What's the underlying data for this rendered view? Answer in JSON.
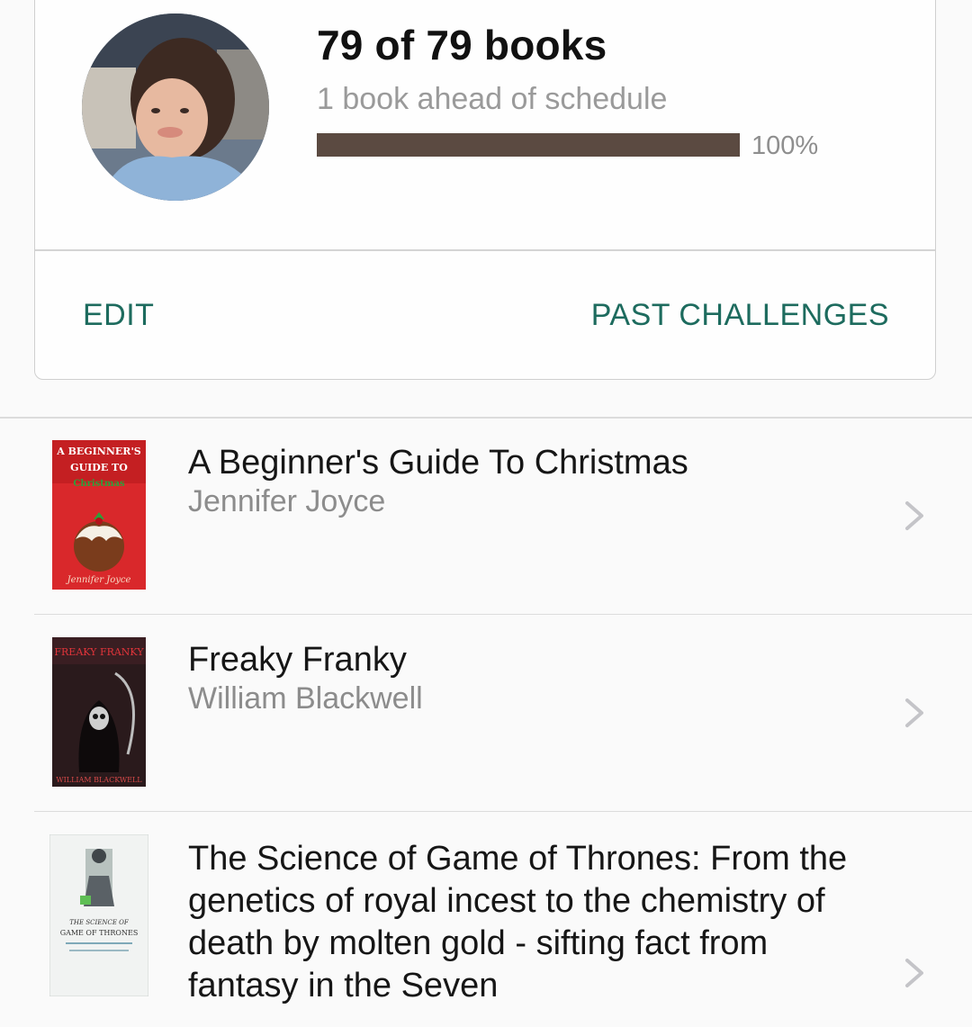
{
  "challenge": {
    "progress_text": "79 of 79 books",
    "schedule_text": "1 book ahead of schedule",
    "progress_fraction": 1.0,
    "progress_percent_label": "100%",
    "edit_label": "EDIT",
    "past_challenges_label": "PAST CHALLENGES",
    "accent_color": "#1d6b5e",
    "progress_color": "#5b4a41"
  },
  "books": [
    {
      "title": "A Beginner's Guide To Christmas",
      "author": "Jennifer Joyce",
      "cover_text": [
        "A BEGINNER'S",
        "GUIDE TO",
        "Christmas",
        "Jennifer Joyce"
      ]
    },
    {
      "title": "Freaky Franky",
      "author": "William Blackwell",
      "cover_text": [
        "FREAKY FRANKY",
        "WILLIAM BLACKWELL"
      ]
    },
    {
      "title": "The Science of Game of Thrones: From the genetics of royal incest to the chemistry of death by molten gold - sifting fact from fantasy in the Seven",
      "author": "",
      "cover_text": [
        "THE SCIENCE OF",
        "GAME OF THRONES"
      ]
    }
  ],
  "icons": {
    "chevron": "chevron-right-icon",
    "avatar": "user-avatar"
  }
}
